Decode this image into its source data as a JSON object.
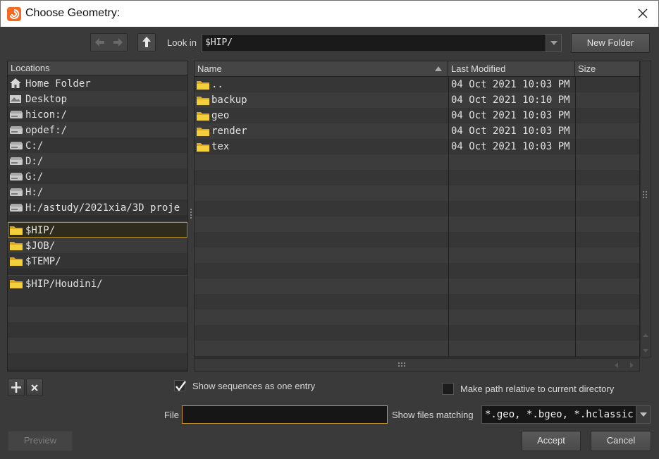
{
  "window": {
    "title": "Choose Geometry:"
  },
  "toolbar": {
    "look_in_label": "Look in",
    "look_in_value": "$HIP/",
    "new_folder_label": "New Folder"
  },
  "locations": {
    "header": "Locations",
    "items": [
      {
        "label": "Home Folder",
        "icon": "home-icon"
      },
      {
        "label": "Desktop",
        "icon": "desktop-icon"
      },
      {
        "label": "hicon:/",
        "icon": "drive-icon"
      },
      {
        "label": "opdef:/",
        "icon": "drive-icon"
      },
      {
        "label": "C:/",
        "icon": "drive-icon"
      },
      {
        "label": "D:/",
        "icon": "drive-icon"
      },
      {
        "label": "G:/",
        "icon": "drive-icon"
      },
      {
        "label": "H:/",
        "icon": "drive-icon"
      },
      {
        "label": "H:/astudy/2021xia/3D proje",
        "icon": "drive-icon"
      }
    ],
    "env_items": [
      {
        "label": "$HIP/",
        "icon": "folder-icon",
        "selected": true
      },
      {
        "label": "$JOB/",
        "icon": "folder-icon"
      },
      {
        "label": "$TEMP/",
        "icon": "folder-icon"
      }
    ],
    "favorite_items": [
      {
        "label": "$HIP/Houdini/",
        "icon": "folder-icon"
      }
    ]
  },
  "file_list": {
    "columns": {
      "name": "Name",
      "modified": "Last Modified",
      "size": "Size"
    },
    "rows": [
      {
        "name": "..",
        "modified": "04 Oct 2021 10:03 PM",
        "size": ""
      },
      {
        "name": "backup",
        "modified": "04 Oct 2021 10:10 PM",
        "size": ""
      },
      {
        "name": "geo",
        "modified": "04 Oct 2021 10:03 PM",
        "size": ""
      },
      {
        "name": "render",
        "modified": "04 Oct 2021 10:03 PM",
        "size": ""
      },
      {
        "name": "tex",
        "modified": "04 Oct 2021 10:03 PM",
        "size": ""
      }
    ]
  },
  "options": {
    "show_sequences_label": "Show sequences as one entry",
    "show_sequences_checked": true,
    "relative_path_label": "Make path relative to current directory",
    "relative_path_checked": false
  },
  "file_field": {
    "label": "File",
    "value": ""
  },
  "filter": {
    "label": "Show files matching",
    "value": "*.geo, *.bgeo, *.hclassic"
  },
  "buttons": {
    "preview": "Preview",
    "accept": "Accept",
    "cancel": "Cancel"
  },
  "colors": {
    "accent": "#c7962d",
    "folder": "#f2c530",
    "houdini_orange": "#f26a24"
  }
}
